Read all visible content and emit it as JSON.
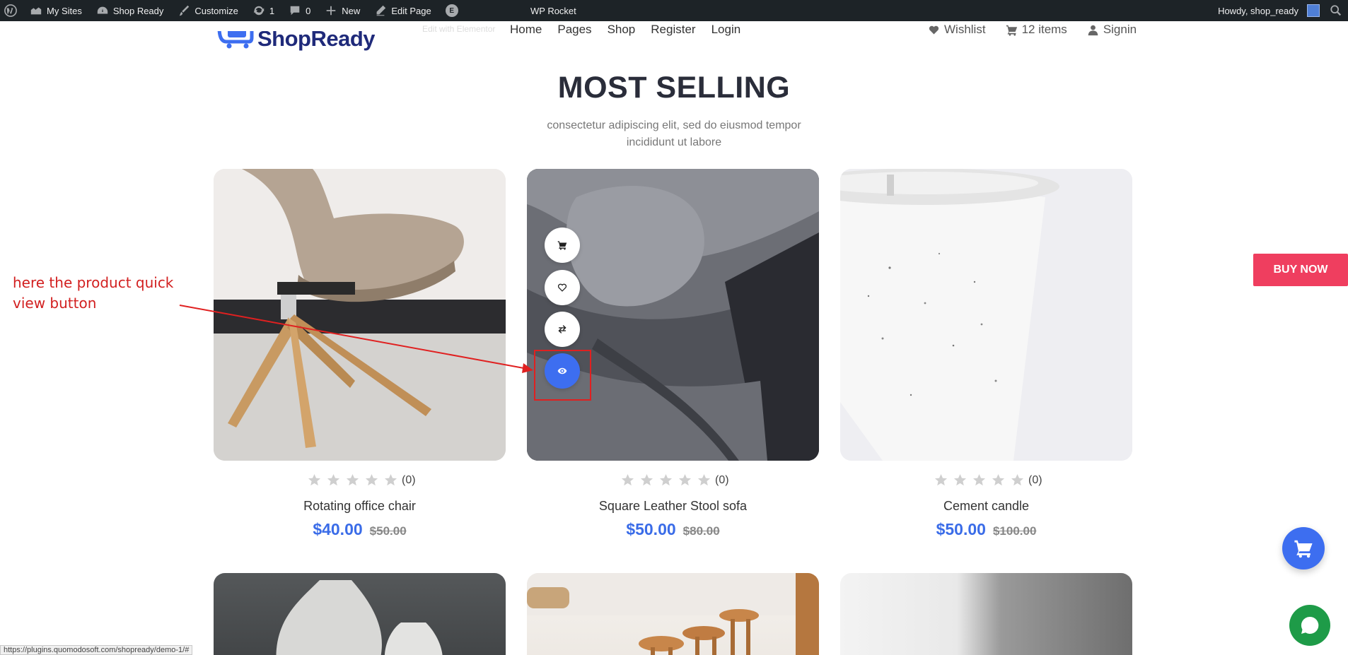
{
  "adminbar": {
    "my_sites": "My Sites",
    "site_name": "Shop Ready",
    "customize": "Customize",
    "updates_count": "1",
    "comments_count": "0",
    "new": "New",
    "edit_page": "Edit Page",
    "center_label": "WP Rocket",
    "howdy": "Howdy, shop_ready"
  },
  "header": {
    "logo_text": "ShopReady",
    "edit_with": "Edit with Elementor",
    "nav": [
      "Home",
      "Pages",
      "Shop",
      "Register",
      "Login"
    ],
    "wishlist": "Wishlist",
    "cart": "12 items",
    "signin": "Signin"
  },
  "section": {
    "title": "MOST SELLING",
    "subtitle": "consectetur adipiscing elit, sed do eiusmod tempor incididunt ut labore"
  },
  "products": [
    {
      "name": "Rotating office chair",
      "price": "$40.00",
      "old_price": "$50.00",
      "rating_count": "(0)",
      "rating": 0
    },
    {
      "name": "Square Leather Stool sofa",
      "price": "$50.00",
      "old_price": "$80.00",
      "rating_count": "(0)",
      "rating": 0
    },
    {
      "name": "Cement candle",
      "price": "$50.00",
      "old_price": "$100.00",
      "rating_count": "(0)",
      "rating": 0
    }
  ],
  "quick_actions": [
    "cart-icon",
    "heart-icon",
    "compare-icon",
    "eye-icon"
  ],
  "annotation": "here the product quick view button",
  "buy_now": "BUY NOW",
  "status_url": "https://plugins.quomodosoft.com/shopready/demo-1/#",
  "colors": {
    "accent": "#3d6ef0",
    "buy_now": "#ef3e5f",
    "annotation": "#d21f1f",
    "chat": "#1e9b48"
  }
}
